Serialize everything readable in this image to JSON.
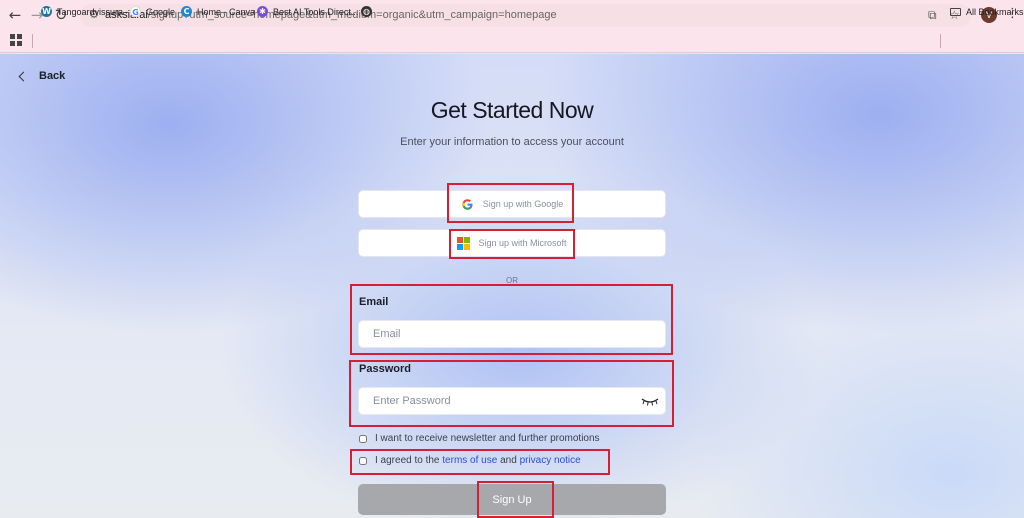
{
  "browser": {
    "url_host": "asksia.ai",
    "url_path": "/signup?utm_source=homepage&utm_medium=organic&utm_campaign=homepage",
    "profile_initial": "V",
    "bookmarks": [
      {
        "label": "Tangoardvissura -",
        "icon": "wordpress-icon",
        "color": "#21759b"
      },
      {
        "label": "Google",
        "icon": "google-icon",
        "color": "#4285f4"
      },
      {
        "label": "Home - Canva",
        "icon": "canva-icon",
        "color": "#1c8ad6"
      },
      {
        "label": "Best AI Tools Direct...",
        "icon": "ai-tools-icon",
        "color": "#7b4cd6"
      }
    ],
    "all_bookmarks_label": "All Bookmarks"
  },
  "page": {
    "back_label": "Back",
    "title": "Get Started Now",
    "subtitle": "Enter your information to access your account",
    "google_label": "Sign up with Google",
    "microsoft_label": "Sign up with Microsoft",
    "or_label": "OR",
    "email_label": "Email",
    "email_placeholder": "Email",
    "password_label": "Password",
    "password_placeholder": "Enter Password",
    "newsletter_label": "I want to receive newsletter and further promotions",
    "agree_prefix": "I agreed to the",
    "terms_label": "terms of use",
    "and_label": "and",
    "privacy_label": "privacy notice",
    "signup_label": "Sign Up"
  },
  "colors": {
    "highlight": "#d51f35",
    "link": "#2b4fd8",
    "signup_button": "#a7a8ab"
  }
}
